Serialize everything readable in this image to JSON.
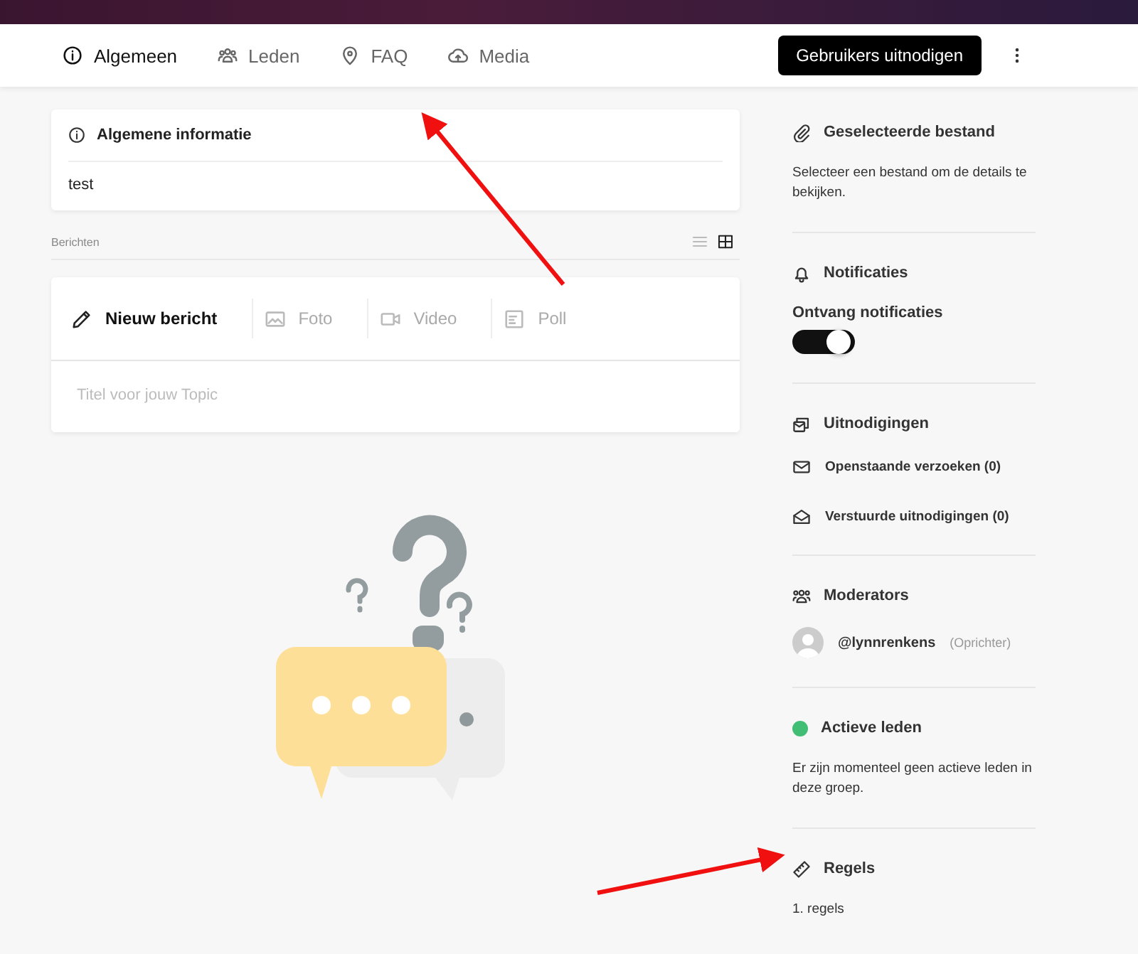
{
  "tabs": [
    {
      "label": "Algemeen",
      "kind": "info",
      "selected": true
    },
    {
      "label": "Leden",
      "kind": "people",
      "selected": false
    },
    {
      "label": "FAQ",
      "kind": "pin",
      "selected": false
    },
    {
      "label": "Media",
      "kind": "cloud",
      "selected": false
    }
  ],
  "invite_button": "Gebruikers uitnodigen",
  "info_card": {
    "title": "Algemene informatie",
    "body": "test"
  },
  "posts": {
    "label": "Berichten",
    "view_modes": [
      {
        "kind": "list",
        "selected": false
      },
      {
        "kind": "grid",
        "selected": true
      }
    ]
  },
  "composer": {
    "tabs": [
      {
        "label": "Nieuw bericht",
        "kind": "pencil",
        "selected": true
      },
      {
        "label": "Foto",
        "kind": "image",
        "selected": false
      },
      {
        "label": "Video",
        "kind": "video",
        "selected": false
      },
      {
        "label": "Poll",
        "kind": "poll",
        "selected": false
      }
    ],
    "placeholder": "Titel voor jouw Topic"
  },
  "sidebar": {
    "selected_file": {
      "title": "Geselecteerde bestand",
      "text": "Selecteer een bestand om de details te bekijken."
    },
    "notifications": {
      "title": "Notificaties",
      "toggle_label": "Ontvang notificaties",
      "on": true
    },
    "invitations": {
      "title": "Uitnodigingen",
      "items": [
        {
          "label": "Openstaande verzoeken (0)",
          "kind": "mail"
        },
        {
          "label": "Verstuurde uitnodigingen (0)",
          "kind": "mail-open"
        }
      ]
    },
    "moderators": {
      "title": "Moderators",
      "items": [
        {
          "handle": "@lynnrenkens",
          "role": "(Oprichter)"
        }
      ]
    },
    "active_members": {
      "title": "Actieve leden",
      "color": "#41bd74",
      "text": "Er zijn momenteel geen actieve leden in deze groep."
    },
    "rules": {
      "title": "Regels",
      "items": [
        "1. regels"
      ]
    }
  }
}
